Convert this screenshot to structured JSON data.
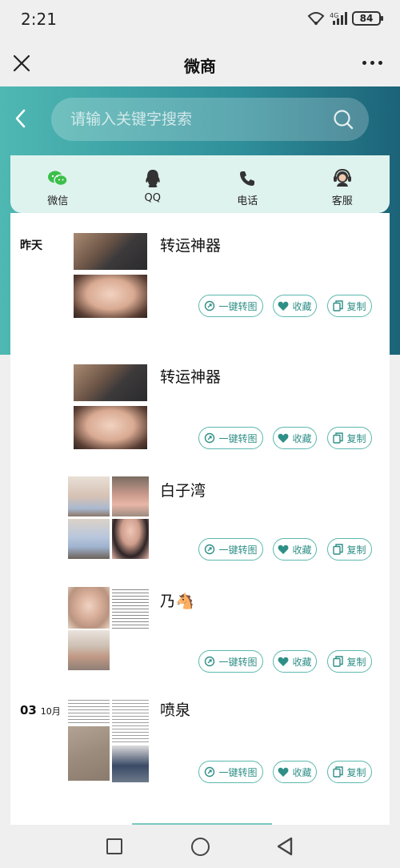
{
  "status": {
    "time": "2:21",
    "battery": "84",
    "network": "4G"
  },
  "titlebar": {
    "title": "微商"
  },
  "search": {
    "placeholder": "请输入关键字搜索"
  },
  "contacts": [
    {
      "label": "微信",
      "icon": "wechat-icon"
    },
    {
      "label": "QQ",
      "icon": "qq-icon"
    },
    {
      "label": "电话",
      "icon": "phone-icon"
    },
    {
      "label": "客服",
      "icon": "customer-service-icon"
    }
  ],
  "actions": {
    "convert": "一键转图",
    "favorite": "收藏",
    "copy": "复制"
  },
  "posts": [
    {
      "date": "昨天",
      "title": "转运神器"
    },
    {
      "date": "",
      "title": "转运神器"
    },
    {
      "date": "",
      "title": "白子湾"
    },
    {
      "date": "",
      "title": "乃🐴"
    },
    {
      "date_day": "03",
      "date_month": "10月",
      "title": "喷泉"
    }
  ],
  "colors": {
    "accent": "#5cb8ae",
    "header_start": "#4fb8b3",
    "header_end": "#1c6378",
    "contact_bg": "#dff3ee"
  }
}
